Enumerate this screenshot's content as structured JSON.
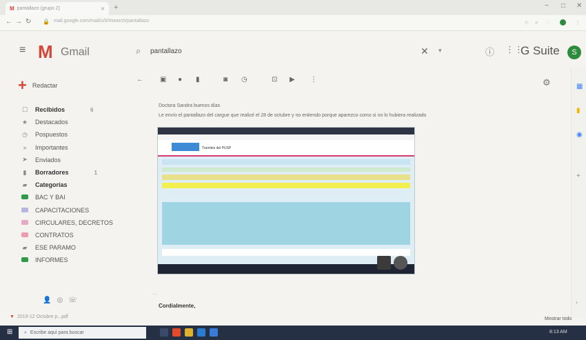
{
  "browser": {
    "tab_title": "pantallazo (grupo 2)",
    "new_tab": "+",
    "url": "mail.google.com/mail/u/0/#search/pantallazo",
    "window_min": "−",
    "window_max": "□",
    "window_close": "✕"
  },
  "gmail": {
    "logo_text": "Gmail",
    "search_value": "pantallazo",
    "brand": "G Suite",
    "avatar_letter": "S",
    "compose_label": "Redactar"
  },
  "sidebar": {
    "items": [
      {
        "label": "Recibidos",
        "icon": "inbox-icon",
        "glyph": "☐",
        "bold": true,
        "count": "6"
      },
      {
        "label": "Destacados",
        "icon": "star-icon",
        "glyph": "★",
        "bold": false
      },
      {
        "label": "Pospuestos",
        "icon": "clock-icon",
        "glyph": "◷",
        "bold": false
      },
      {
        "label": "Importantes",
        "icon": "important-icon",
        "glyph": "»",
        "bold": false
      },
      {
        "label": "Enviados",
        "icon": "send-icon",
        "glyph": "➤",
        "bold": false
      },
      {
        "label": "Borradores",
        "icon": "draft-icon",
        "glyph": "▮",
        "bold": true,
        "count": "1"
      },
      {
        "label": "Categorías",
        "icon": "label-icon",
        "glyph": "▰",
        "bold": true
      },
      {
        "label": "BAC Y BAI",
        "icon": "label-icon",
        "color": "#2e9b4a",
        "bold": false
      },
      {
        "label": "CAPACITACIONES",
        "icon": "label-icon",
        "color": "#b8b4e0",
        "bold": false
      },
      {
        "label": "CIRCULARES, DECRETOS",
        "icon": "label-icon",
        "color": "#e7a8c4",
        "bold": false
      },
      {
        "label": "CONTRATOS",
        "icon": "label-icon",
        "color": "#ee9ab0",
        "bold": false
      },
      {
        "label": "ESE PARAMO",
        "icon": "label-icon",
        "glyph": "▰",
        "bold": false
      },
      {
        "label": "INFORMES",
        "icon": "label-icon",
        "color": "#2e9b4a",
        "bold": false
      }
    ],
    "footer_icons": [
      "person-icon",
      "hangouts-icon",
      "phone-icon"
    ]
  },
  "message": {
    "greeting": "Doctora Sandra buenos días",
    "body": "Le envío el pantallazo del cargue que realicé el 28 de octubre y no entiendo porque aparezco como si no lo hubiera realizado",
    "closing": "Cordialmente,",
    "collapsed": "...",
    "attachment": "2019-12 Octubre p...pdf",
    "show_all": "Mostrar todo",
    "embedded_title": "Tramites del PUSP"
  },
  "taskbar": {
    "search_placeholder": "Escribe aquí para buscar",
    "clock": "8:13 AM"
  }
}
